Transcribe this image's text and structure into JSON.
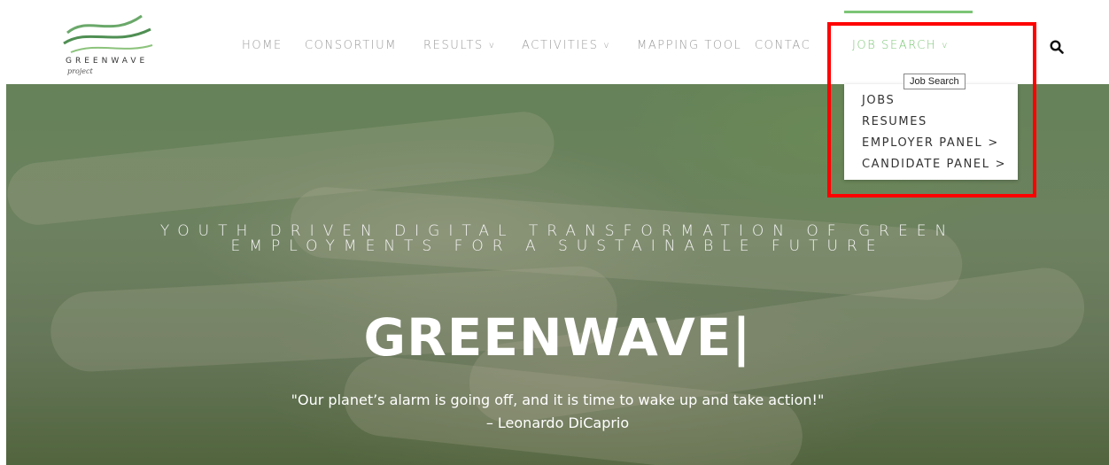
{
  "logo": {
    "name": "GREENWAVE",
    "sub": "project"
  },
  "nav": {
    "items": [
      {
        "label": "HOME"
      },
      {
        "label": "CONSORTIUM"
      },
      {
        "label": "RESULTS",
        "chevron": "v"
      },
      {
        "label": "ACTIVITIES",
        "chevron": "v"
      },
      {
        "label": "MAPPING TOOL"
      },
      {
        "label": "CONTAC"
      },
      {
        "label": "JOB SEARCH",
        "chevron": "v"
      }
    ],
    "search_icon": "search-icon"
  },
  "dropdown": {
    "tooltip": "Job Search",
    "items": [
      {
        "label": "JOBS"
      },
      {
        "label": "RESUMES"
      },
      {
        "label": "EMPLOYER PANEL",
        "arrow": ">"
      },
      {
        "label": "CANDIDATE PANEL",
        "arrow": ">"
      }
    ]
  },
  "hero": {
    "tagline_line1": "YOUTH DRIVEN DIGITAL TRANSFORMATION OF GREEN",
    "tagline_line2": "EMPLOYMENTS FOR A SUSTAINABLE FUTURE",
    "brand": "GREENWAVE|",
    "quote": "\"Our planet’s alarm is going off, and it is time to wake up and take action!\"",
    "author": "– Leonardo DiCaprio"
  },
  "colors": {
    "accent": "#7cc576",
    "highlight": "#ff0000",
    "nav_text": "#9a9a9a"
  }
}
